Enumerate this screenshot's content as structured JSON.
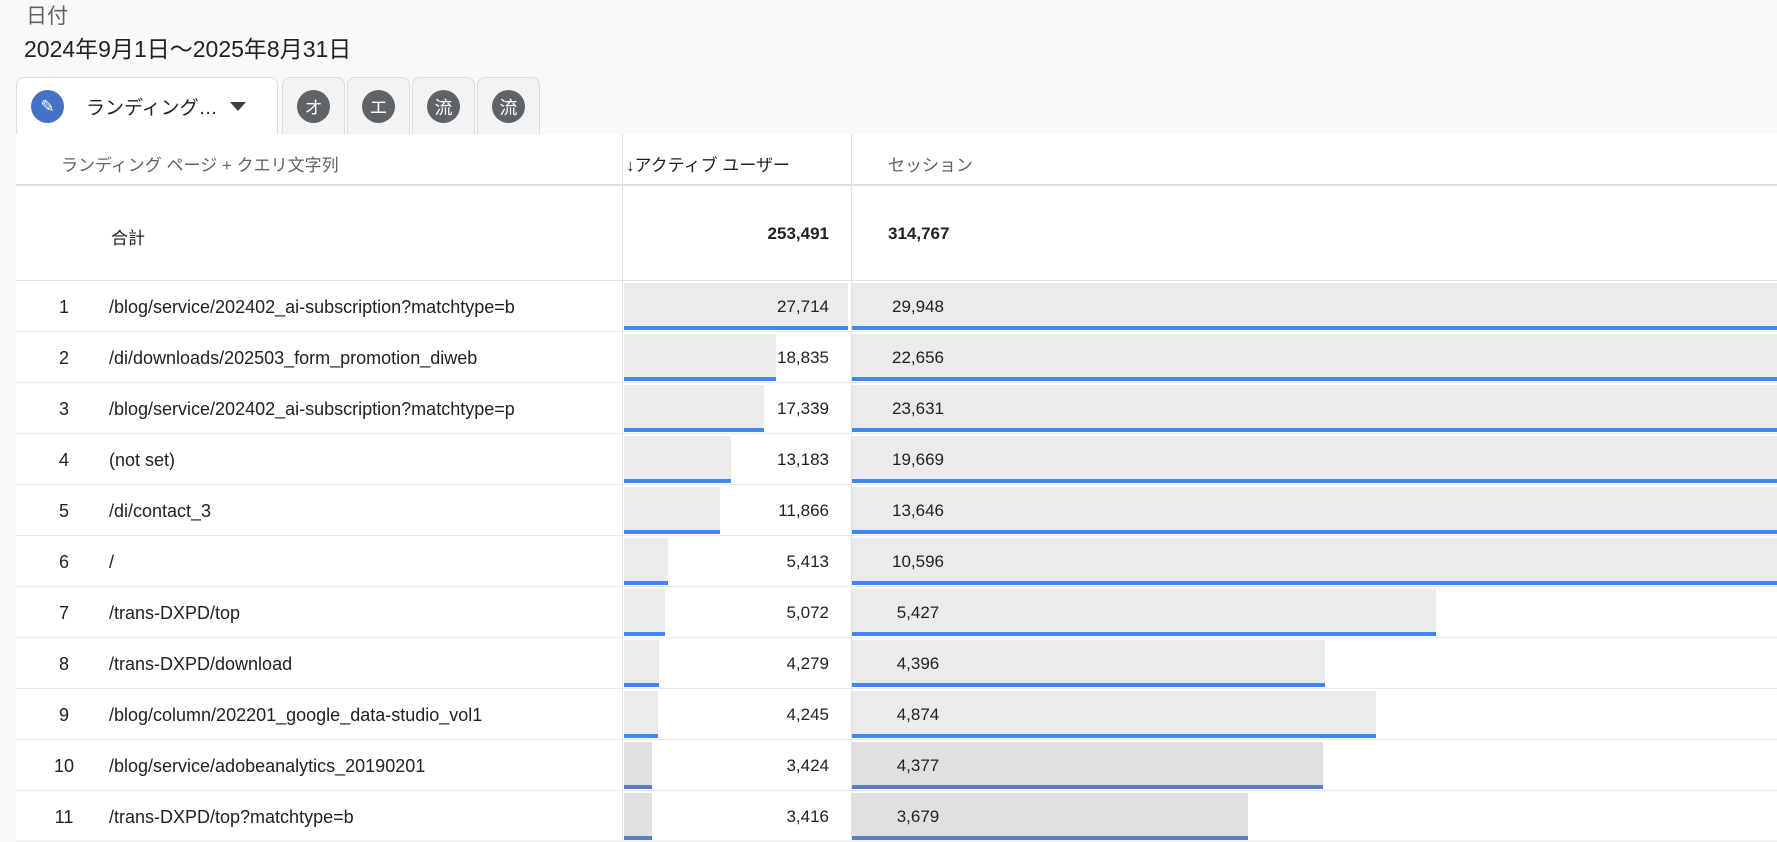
{
  "filter": {
    "label": "日付",
    "value": "2024年9月1日～2025年8月31日"
  },
  "tabs": [
    {
      "icon": "pencil-icon",
      "glyph": "✎",
      "label": "ランディング…"
    },
    {
      "glyph": "オ"
    },
    {
      "glyph": "エ"
    },
    {
      "glyph": "流"
    },
    {
      "glyph": "流"
    }
  ],
  "table": {
    "headers": {
      "dimension": "ランディング ページ + クエリ文字列",
      "active_users": "↓アクティブ ユーザー",
      "sessions": "セッション"
    },
    "total": {
      "label": "合計",
      "active_users": "253,491",
      "sessions": "314,767"
    },
    "rows": [
      {
        "rank": "1",
        "path": "/blog/service/202402_ai-subscription?matchtype=b",
        "active_users": "27,714",
        "sessions": "29,948",
        "au": 27714,
        "s": 29948
      },
      {
        "rank": "2",
        "path": "/di/downloads/202503_form_promotion_diweb",
        "active_users": "18,835",
        "sessions": "22,656",
        "au": 18835,
        "s": 22656
      },
      {
        "rank": "3",
        "path": "/blog/service/202402_ai-subscription?matchtype=p",
        "active_users": "17,339",
        "sessions": "23,631",
        "au": 17339,
        "s": 23631
      },
      {
        "rank": "4",
        "path": "(not set)",
        "active_users": "13,183",
        "sessions": "19,669",
        "au": 13183,
        "s": 19669
      },
      {
        "rank": "5",
        "path": "/di/contact_3",
        "active_users": "11,866",
        "sessions": "13,646",
        "au": 11866,
        "s": 13646
      },
      {
        "rank": "6",
        "path": "/",
        "active_users": "5,413",
        "sessions": "10,596",
        "au": 5413,
        "s": 10596
      },
      {
        "rank": "7",
        "path": "/trans-DXPD/top",
        "active_users": "5,072",
        "sessions": "5,427",
        "au": 5072,
        "s": 5427
      },
      {
        "rank": "8",
        "path": "/trans-DXPD/download",
        "active_users": "4,279",
        "sessions": "4,396",
        "au": 4279,
        "s": 4396
      },
      {
        "rank": "9",
        "path": "/blog/column/202201_google_data-studio_vol1",
        "active_users": "4,245",
        "sessions": "4,874",
        "au": 4245,
        "s": 4874
      },
      {
        "rank": "10",
        "path": "/blog/service/adobeanalytics_20190201",
        "active_users": "3,424",
        "sessions": "4,377",
        "au": 3424,
        "s": 4377,
        "highlight": true
      },
      {
        "rank": "11",
        "path": "/trans-DXPD/top?matchtype=b",
        "active_users": "3,416",
        "sessions": "3,679",
        "au": 3416,
        "s": 3679,
        "highlight": true
      }
    ]
  },
  "colors": {
    "bar_accent": "#4285f4",
    "bar_fill": "#ebebeb"
  }
}
